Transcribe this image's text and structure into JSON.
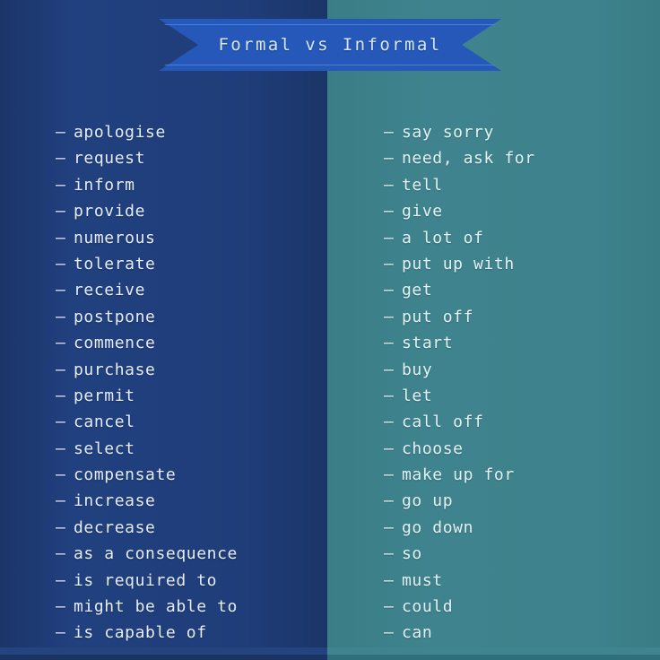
{
  "banner": {
    "title": "Formal vs Informal",
    "fill_color": "#2558b8",
    "text_color": "#d8e8fb"
  },
  "theme": {
    "left_background": "#1e3b76",
    "right_background": "#3c8089",
    "left_text": "#e7eefb",
    "right_text": "#e4f2f3"
  },
  "columns": {
    "formal": {
      "name": "Formal",
      "bullet": "–",
      "items": [
        "apologise",
        "request",
        "inform",
        "provide",
        "numerous",
        "tolerate",
        "receive",
        "postpone",
        "commence",
        "purchase",
        "permit",
        "cancel",
        "select",
        "compensate",
        "increase",
        "decrease",
        "as a consequence",
        "is required to",
        "might be able to",
        "is capable of"
      ]
    },
    "informal": {
      "name": "Informal",
      "bullet": "–",
      "items": [
        "say sorry",
        "need, ask for",
        "tell",
        "give",
        "a lot of",
        "put up with",
        "get",
        "put off",
        "start",
        "buy",
        "let",
        "call off",
        "choose",
        "make up for",
        "go up",
        "go down",
        "so",
        "must",
        "could",
        "can"
      ]
    }
  }
}
